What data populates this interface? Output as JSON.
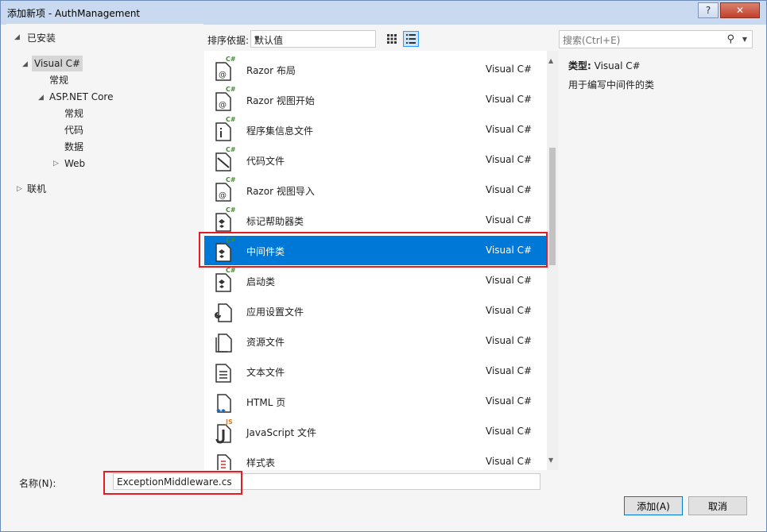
{
  "window": {
    "title": "添加新项 - AuthManagement",
    "help_label": "?",
    "close_label": "✕"
  },
  "tree": {
    "installed": "已安装",
    "visual_csharp": "Visual C#",
    "general": "常规",
    "aspnet_core": "ASP.NET Core",
    "aspnet_general": "常规",
    "code": "代码",
    "data": "数据",
    "web": "Web",
    "online": "联机"
  },
  "toolbar": {
    "sort_label": "排序依据:",
    "sort_value": "默认值"
  },
  "search": {
    "placeholder": "搜索(Ctrl+E)"
  },
  "templates": [
    {
      "name": "Razor 布局",
      "type": "Visual C#",
      "icon": "razor-icon"
    },
    {
      "name": "Razor 视图开始",
      "type": "Visual C#",
      "icon": "razor-icon"
    },
    {
      "name": "程序集信息文件",
      "type": "Visual C#",
      "icon": "info-file-icon"
    },
    {
      "name": "代码文件",
      "type": "Visual C#",
      "icon": "code-file-icon"
    },
    {
      "name": "Razor 视图导入",
      "type": "Visual C#",
      "icon": "razor-icon"
    },
    {
      "name": "标记帮助器类",
      "type": "Visual C#",
      "icon": "class-icon"
    },
    {
      "name": "中间件类",
      "type": "Visual C#",
      "icon": "class-icon"
    },
    {
      "name": "启动类",
      "type": "Visual C#",
      "icon": "class-icon"
    },
    {
      "name": "应用设置文件",
      "type": "Visual C#",
      "icon": "settings-file-icon"
    },
    {
      "name": "资源文件",
      "type": "Visual C#",
      "icon": "resource-file-icon"
    },
    {
      "name": "文本文件",
      "type": "Visual C#",
      "icon": "text-file-icon"
    },
    {
      "name": "HTML 页",
      "type": "Visual C#",
      "icon": "html-file-icon"
    },
    {
      "name": "JavaScript 文件",
      "type": "Visual C#",
      "icon": "js-file-icon"
    },
    {
      "name": "样式表",
      "type": "Visual C#",
      "icon": "stylesheet-icon"
    }
  ],
  "selected_index": 6,
  "details": {
    "type_label": "类型:",
    "type_value": "Visual C#",
    "description": "用于编写中间件的类"
  },
  "form": {
    "name_label": "名称(N):",
    "name_value": "ExceptionMiddleware.cs",
    "add_label": "添加(A)",
    "cancel_label": "取消"
  },
  "colors": {
    "selection": "#0078d7",
    "highlight_box": "#e21d25",
    "titlebar": "#c9daf0"
  }
}
